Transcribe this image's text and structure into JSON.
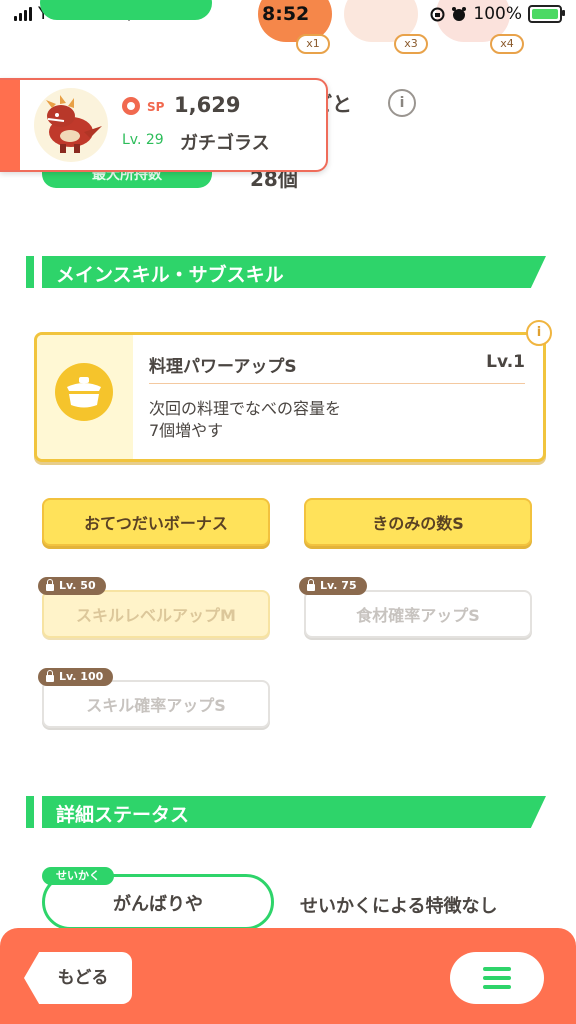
{
  "status_bar": {
    "carrier": "Y!mobile",
    "time": "8:52",
    "battery": "100%"
  },
  "berries": [
    {
      "count": "x1",
      "color": "#f5874a"
    },
    {
      "count": "x3",
      "color": "#fbe7dd"
    },
    {
      "count": "x4",
      "color": "#fbe2dc"
    }
  ],
  "pokemon_card": {
    "sp_label": "SP",
    "sp_value": "1,629",
    "level": "Lv. 29",
    "name": "ガチゴラス"
  },
  "partial_title": "ごと",
  "info_glyph": "i",
  "max_held": {
    "label": "最大所持数",
    "value": "28個"
  },
  "skills_section": {
    "title": "メインスキル・サブスキル"
  },
  "main_skill": {
    "name": "料理パワーアップS",
    "level": "Lv.1",
    "description": "次回の料理でなべの容量を\n7個増やす"
  },
  "sub_skills": [
    {
      "label": "おてつだいボーナス",
      "locked": false
    },
    {
      "label": "きのみの数S",
      "locked": false
    },
    {
      "label": "スキルレベルアップM",
      "locked": true,
      "unlock_level": "Lv. 50"
    },
    {
      "label": "食材確率アップS",
      "locked": true,
      "unlock_level": "Lv. 75"
    },
    {
      "label": "スキル確率アップS",
      "locked": true,
      "unlock_level": "Lv. 100"
    }
  ],
  "details_section": {
    "title": "詳細ステータス"
  },
  "nature": {
    "tag": "せいかく",
    "value": "がんばりや",
    "effect": "せいかくによる特徴なし"
  },
  "bottom_nav": {
    "back_label": "もどる"
  },
  "colors": {
    "accent_green": "#2ed46a",
    "accent_orange": "#ff7150",
    "skill_yellow": "#ffe25a"
  }
}
